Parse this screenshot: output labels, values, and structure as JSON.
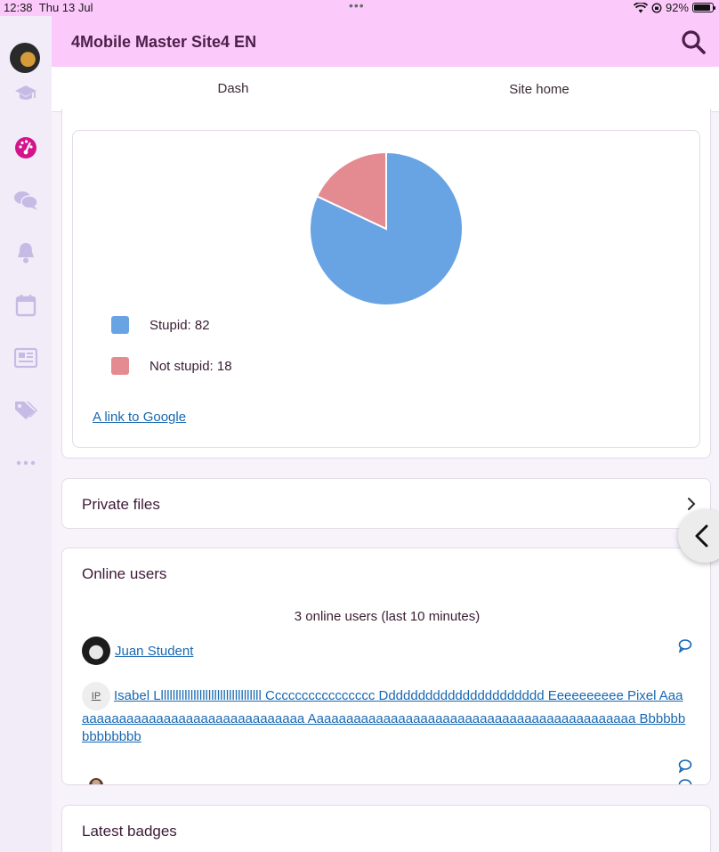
{
  "status_bar": {
    "time": "12:38",
    "date": "Thu 13 Jul",
    "dots": "•••",
    "battery": "92%"
  },
  "header": {
    "site_title": "4Mobile Master Site4 EN"
  },
  "tabs": [
    {
      "label": "Dash"
    },
    {
      "label": "Site home"
    }
  ],
  "chart_data": {
    "type": "pie",
    "categories": [
      "Stupid",
      "Not stupid"
    ],
    "values": [
      82,
      18
    ],
    "colors": [
      "#68a3e4",
      "#e38b90"
    ],
    "legend": [
      "Stupid: 82",
      "Not stupid: 18"
    ]
  },
  "chart_block": {
    "link": "A link to Google"
  },
  "private_files": {
    "title": "Private files"
  },
  "online_users": {
    "title": "Online users",
    "summary": "3 online users (last 10 minutes)",
    "users": [
      {
        "name": "Juan Student"
      },
      {
        "initials": "IP",
        "name": "Isabel Lllllllllllllllllllllllllllllllllll Cccccccccccccccc Dddddddddddddddddddddd Eeeeeeeeee Pixel Aaaaaaaaaaaaaaaaaaaaaaaaaaaaaaaaa Aaaaaaaaaaaaaaaaaaaaaaaaaaaaaaaaaaaaaaaaaaaa Bbbbbbbbbbbbbb"
      }
    ]
  },
  "latest_badges": {
    "title": "Latest badges"
  },
  "colors": {
    "header_bg": "#fbc9fa",
    "accent": "#b3197a",
    "link": "#1768b2"
  },
  "icons": [
    "avatar",
    "graduation-cap-icon",
    "dashboard-icon",
    "messages-icon",
    "bell-icon",
    "calendar-icon",
    "news-icon",
    "tags-icon",
    "more-icon",
    "search-icon",
    "chevron-right-icon",
    "chevron-left-icon",
    "message-icon"
  ]
}
